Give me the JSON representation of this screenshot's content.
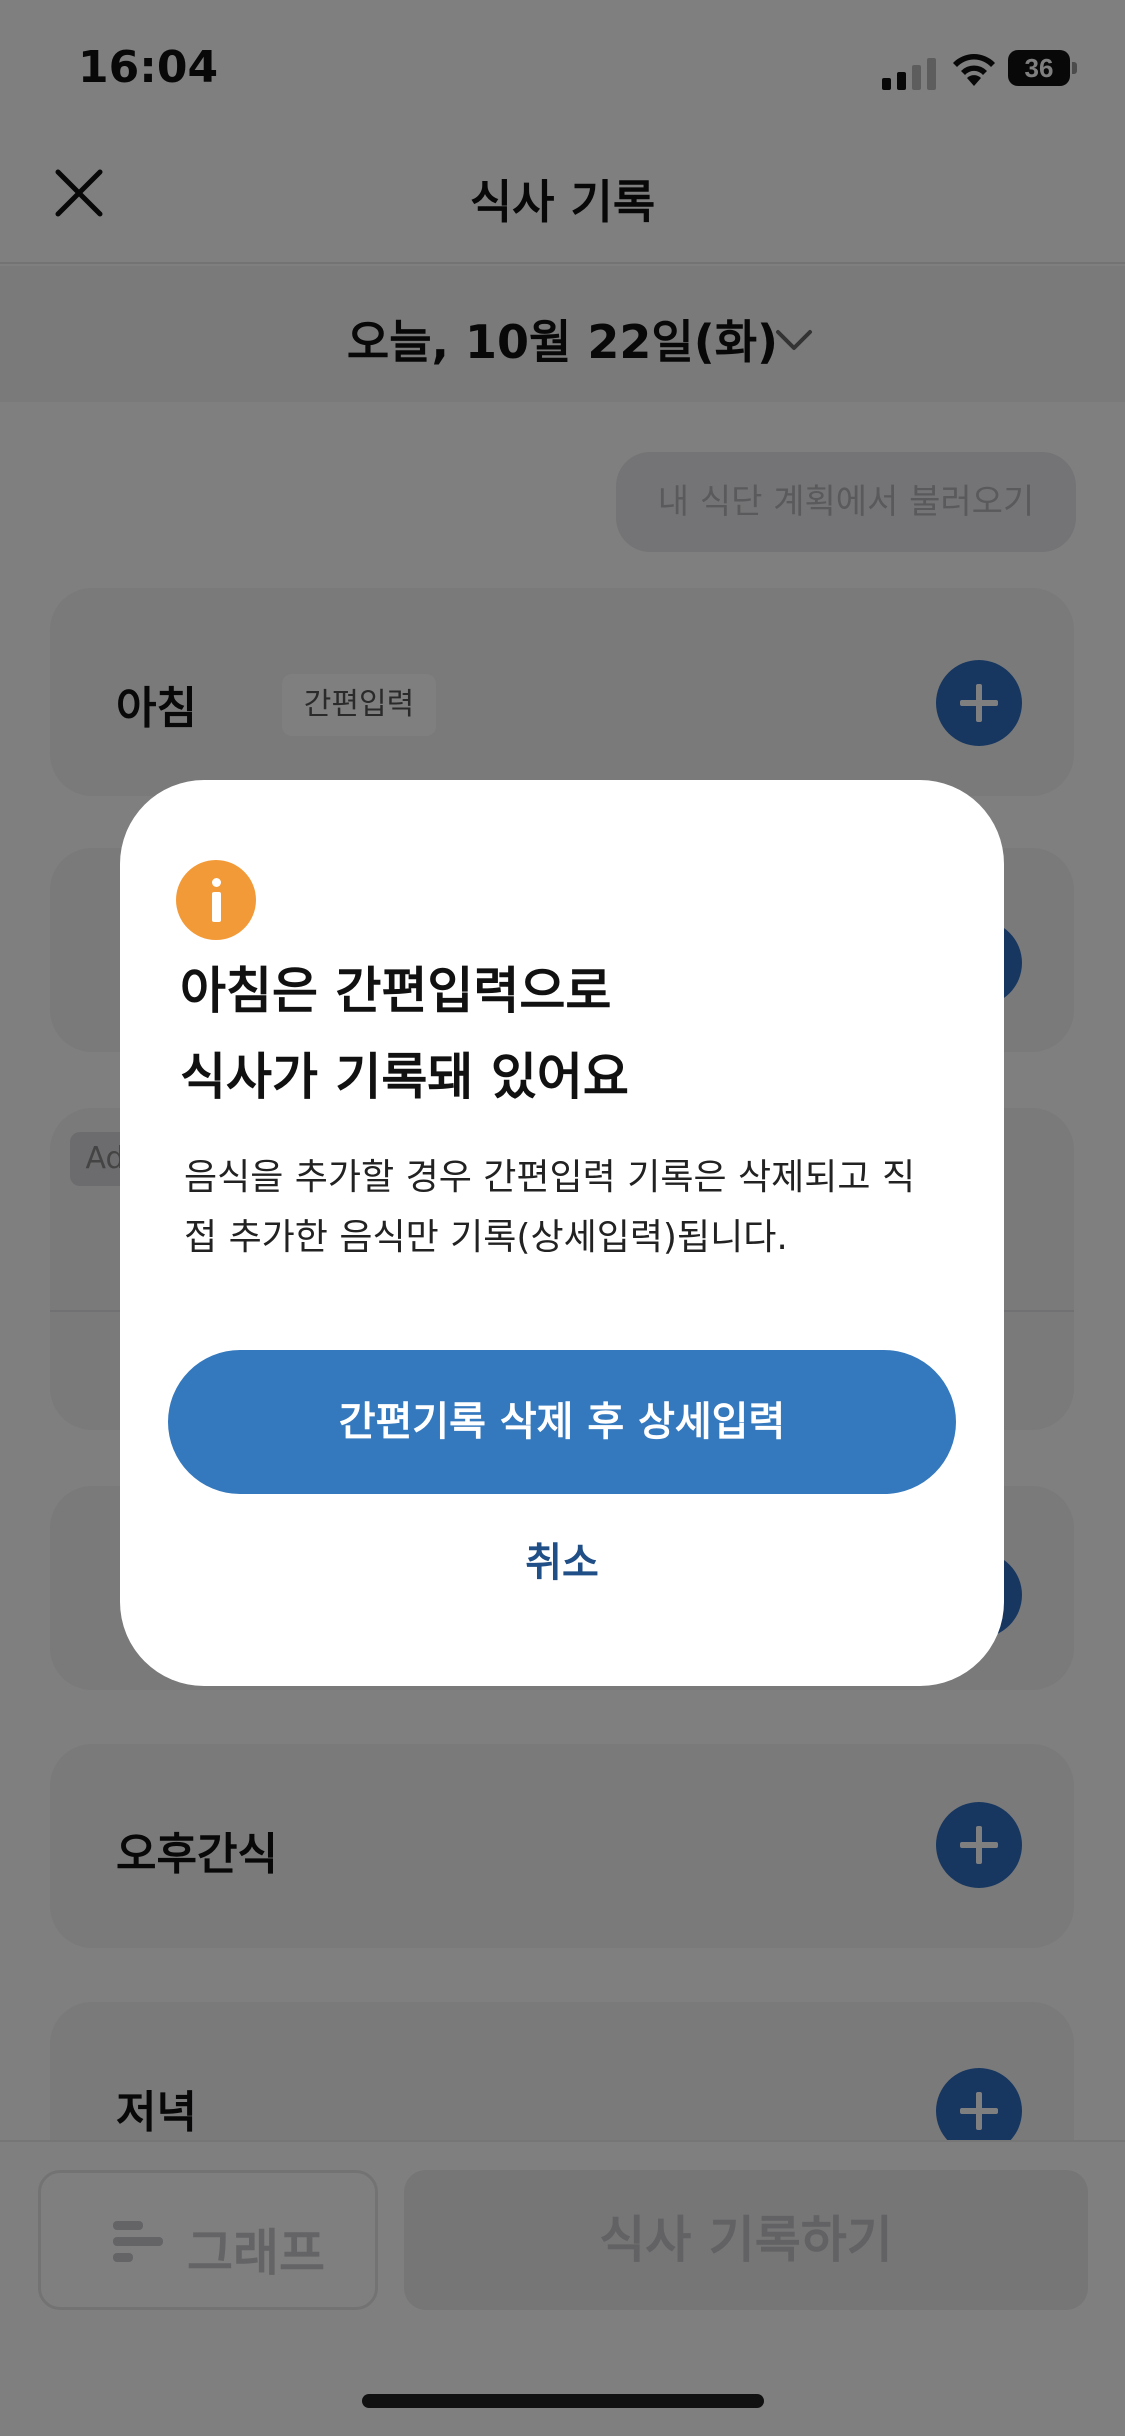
{
  "status_bar": {
    "time": "16:04",
    "battery": "36"
  },
  "header": {
    "title": "식사 기록"
  },
  "date_bar": {
    "label": "오늘, 10월 22일(화)"
  },
  "plan_button": {
    "label": "내 식단 계획에서 불러오기"
  },
  "meals": {
    "breakfast": {
      "title": "아침",
      "tag": "간편입력"
    },
    "ad": {
      "badge": "Ad"
    },
    "afternoon_snack": {
      "title": "오후간식"
    },
    "dinner": {
      "title": "저녁"
    }
  },
  "bottom_bar": {
    "graph_label": "그래프",
    "record_label": "식사 기록하기"
  },
  "dialog": {
    "title_line1": "아침은 간편입력으로",
    "title_line2": "식사가 기록돼 있어요",
    "body": "음식을 추가할 경우 간편입력 기록은 삭제되고 직접 추가한 음식만 기록(상세입력)됩니다.",
    "primary_label": "간편기록 삭제 후 상세입력",
    "cancel_label": "취소"
  },
  "colors": {
    "accent": "#2f6fc0",
    "dialog_button": "#3478be",
    "info": "#f39a38",
    "cancel_text": "#1f4f86"
  }
}
